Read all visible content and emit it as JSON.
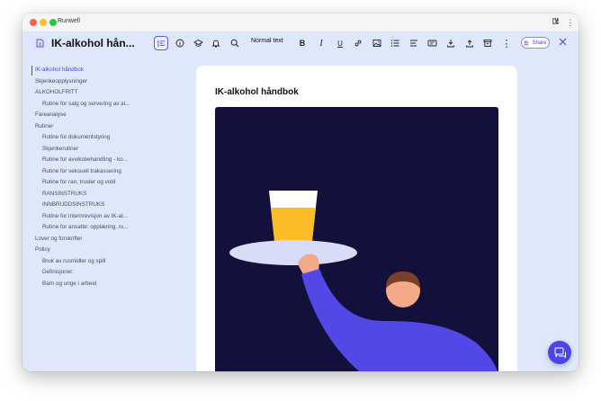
{
  "window": {
    "app_name": "Runwell"
  },
  "toolbar": {
    "doc_title": "IK-alkohol hån...",
    "format_select": "Normal text",
    "share_label": "Share",
    "icons": [
      "outline-icon",
      "info-icon",
      "graduation-cap-icon",
      "bell-icon",
      "search-icon",
      "bold-icon",
      "italic-icon",
      "underline-icon",
      "link-icon",
      "image-icon",
      "bullet-list-icon",
      "align-icon",
      "embed-icon",
      "download-icon",
      "upload-icon",
      "archive-icon",
      "more-icon",
      "share-icon",
      "close-icon"
    ]
  },
  "sidebar": {
    "items": [
      {
        "label": "IK-alkohol håndbok",
        "active": true
      },
      {
        "label": "Skjenkeopplysninger"
      },
      {
        "label": "ALKOHOLFRITT"
      },
      {
        "label": "Rutine for salg og servering av al..."
      },
      {
        "label": "Fareanalyse"
      },
      {
        "label": "Rutiner"
      },
      {
        "label": "Rutine for dokumentstyring"
      },
      {
        "label": "Skjenkerutiner"
      },
      {
        "label": "Rutine for avviksbehandling - ko..."
      },
      {
        "label": "Rutine for seksuell trakassering"
      },
      {
        "label": "Rutine for ran, trusler og vold"
      },
      {
        "label": "RANSINSTRUKS"
      },
      {
        "label": "INNBRUDDSINSTRUKS"
      },
      {
        "label": "Rutine for internrevisjon av IK-al..."
      },
      {
        "label": "Rutine for ansatte: opplæring, ru..."
      },
      {
        "label": "Lover og forskrifter"
      },
      {
        "label": "Policy"
      },
      {
        "label": "Bruk av rusmidler og spill"
      },
      {
        "label": "Definisjoner:"
      },
      {
        "label": "Barn og unge i arbeid"
      }
    ]
  },
  "document": {
    "heading": "IK-alkohol håndbok"
  },
  "colors": {
    "accent": "#4b47e6",
    "window_bg": "#dfe8fb",
    "illustration_bg": "#13103b",
    "beer": "#fbbd26",
    "sleeve": "#5148e6"
  }
}
